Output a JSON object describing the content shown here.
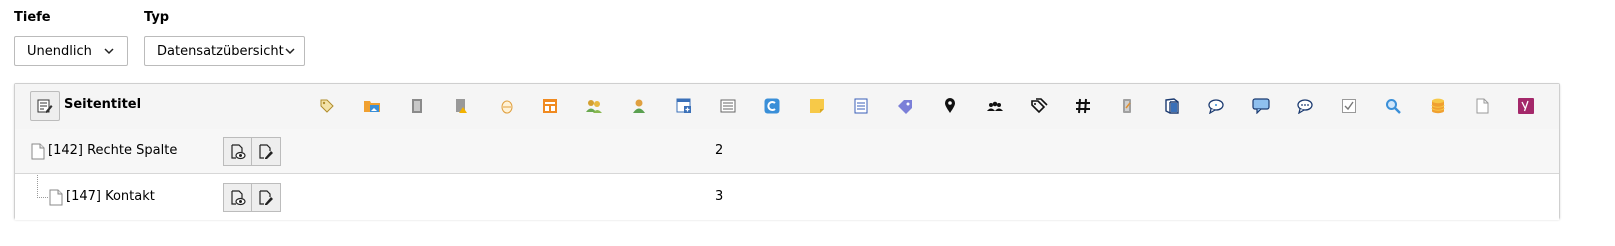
{
  "filters": {
    "depth": {
      "label": "Tiefe",
      "value": "Unendlich"
    },
    "type": {
      "label": "Typ",
      "value": "Datensatzübersicht"
    }
  },
  "table": {
    "header_title": "Seitentitel",
    "column_icons": [
      "tag-icon",
      "folder-image-icon",
      "document-gray-icon",
      "document-warning-icon",
      "egg-icon",
      "orange-layout-icon",
      "users-icon",
      "user-icon",
      "window-add-icon",
      "text-lines-icon",
      "refresh-c-icon",
      "sticky-note-icon",
      "document-lines-icon",
      "label-purple-icon",
      "map-pin-icon",
      "group-icon",
      "tags-black-icon",
      "hashtag-icon",
      "pencil-gray-icon",
      "book-icon",
      "speech-bubble-icon",
      "comment-blue-icon",
      "comment-dots-icon",
      "checkbox-icon",
      "search-icon",
      "database-icon",
      "blank-page-icon",
      "yoast-icon"
    ],
    "rows": [
      {
        "title": "[142] Rechte Spalte",
        "count": "2"
      },
      {
        "title": "[147] Kontakt",
        "count": "3"
      }
    ]
  },
  "colors": {
    "border": "#cfcfcf",
    "header_bg": "#f5f5f5",
    "row_alt_bg": "#f7f7f7",
    "yoast": "#a4286a",
    "blue": "#3a8fd8",
    "orange": "#f0a030"
  }
}
